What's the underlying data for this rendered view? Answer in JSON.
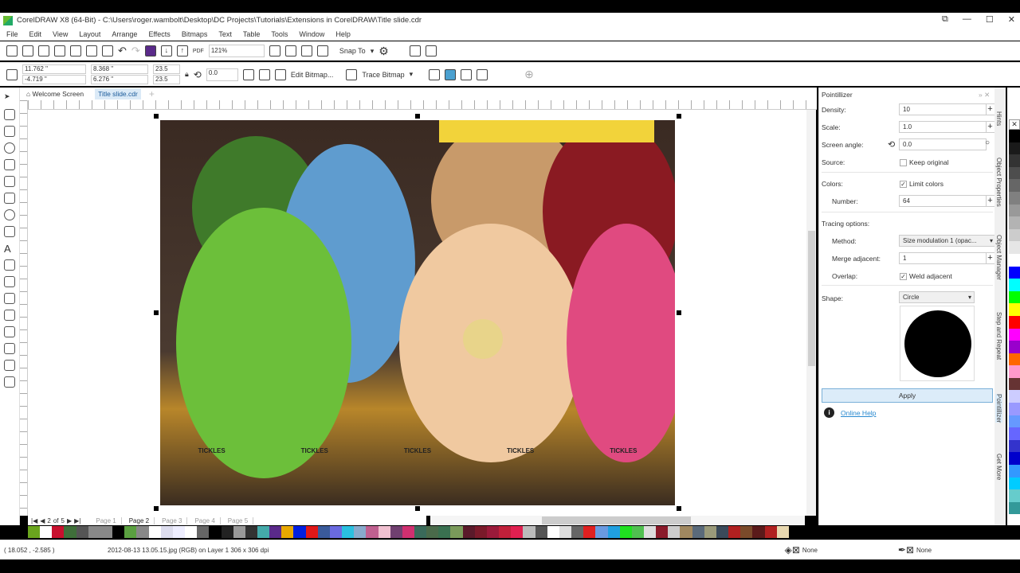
{
  "window": {
    "title": "CorelDRAW X8 (64-Bit) - C:\\Users\\roger.wambolt\\Desktop\\DC Projects\\Tutorials\\Extensions in CorelDRAW\\Title slide.cdr"
  },
  "menu": [
    "File",
    "Edit",
    "View",
    "Layout",
    "Arrange",
    "Effects",
    "Bitmaps",
    "Text",
    "Table",
    "Tools",
    "Window",
    "Help"
  ],
  "toolbar": {
    "zoom": "121%",
    "snap_to": "Snap To"
  },
  "propbar": {
    "x": "11.762 \"",
    "y": "-4.719 \"",
    "w": "8.368 \"",
    "h": "6.276 \"",
    "scale_x": "23.5",
    "scale_y": "23.5",
    "pct": "%",
    "angle": "0.0",
    "edit_bitmap": "Edit Bitmap...",
    "trace_bitmap": "Trace Bitmap"
  },
  "tabs": [
    "Welcome Screen",
    "Title slide.cdr"
  ],
  "pagenav": {
    "current": "2",
    "of": "of",
    "total": "5",
    "pages": [
      "Page 1",
      "Page 2",
      "Page 3",
      "Page 4",
      "Page 5"
    ],
    "active": 1
  },
  "photo_labels": [
    "TICKLES",
    "TICKLES",
    "TICKLES",
    "TICKLES",
    "TICKLES"
  ],
  "status": {
    "coords": "( 18.052 , -2.585 )",
    "info": "2012-08-13 13.05.15.jpg (RGB) on Layer 1 306 x 306 dpi",
    "fill": "None",
    "outline": "None"
  },
  "docker": {
    "title": "Pointillizer",
    "density_label": "Density:",
    "density": "10",
    "scale_label": "Scale:",
    "scale": "1.0",
    "angle_label": "Screen angle:",
    "angle": "0.0",
    "source_label": "Source:",
    "keep_original": "Keep original",
    "keep_original_checked": false,
    "colors_label": "Colors:",
    "limit_colors": "Limit colors",
    "limit_colors_checked": true,
    "number_label": "Number:",
    "number": "64",
    "tracing_label": "Tracing options:",
    "method_label": "Method:",
    "method": "Size modulation 1 (opac...",
    "merge_label": "Merge adjacent:",
    "merge": "1",
    "overlap_label": "Overlap:",
    "weld_adjacent": "Weld adjacent",
    "weld_checked": true,
    "shape_label": "Shape:",
    "shape": "Circle",
    "apply": "Apply",
    "online_help": "Online Help"
  },
  "docker_tabs": [
    "Hints",
    "Object Properties",
    "Object Manager",
    "Step and Repeat",
    "Pointillizer",
    "Get More"
  ],
  "palette_bottom": [
    "#6aa51e",
    "#ffffff",
    "#c8102e",
    "#3f6f3a",
    "#555",
    "#888",
    "#888",
    "#000",
    "#5aa040",
    "#888",
    "#fff",
    "#dde",
    "#eef",
    "#fff",
    "#666",
    "#000",
    "#222",
    "#999",
    "#333",
    "#4aa",
    "#5a2a8a",
    "#e8a800",
    "#0020e0",
    "#e01818",
    "#3a5a9a",
    "#6a6ae0",
    "#2ac0e0",
    "#8ac",
    "#c06090",
    "#f0c0d0",
    "#704070",
    "#d03070",
    "#3a6a5a",
    "#4a6a4a",
    "#3a7050",
    "#7a9a5a",
    "#5a1a2a",
    "#7a1a2a",
    "#9a1a3a",
    "#c0203a",
    "#e02050",
    "#bbb",
    "#555",
    "#fff",
    "#ddd",
    "#666",
    "#e02020",
    "#6a9ae0",
    "#20a0e0",
    "#20e020",
    "#50c050",
    "#ddd",
    "#8a1a2a",
    "#ccc",
    "#a08860",
    "#5a6a7a",
    "#9a9a7a",
    "#3a4a5a",
    "#b02020",
    "#7a4a2a",
    "#5a1a1a",
    "#b02020",
    "#e8d8b0"
  ],
  "palette_right": [
    "#000",
    "#1a1a1a",
    "#333",
    "#4d4d4d",
    "#666",
    "#808080",
    "#999",
    "#b3b3b3",
    "#ccc",
    "#e6e6e6",
    "#fff",
    "#0000ff",
    "#00ffff",
    "#00ff00",
    "#ffff00",
    "#ff0000",
    "#ff00ff",
    "#9900cc",
    "#ff6600",
    "#ff99cc",
    "#663333",
    "#ccccff",
    "#9999ff",
    "#6699ff",
    "#6666ff",
    "#3333cc",
    "#0000cc",
    "#3399ff",
    "#00ccff",
    "#66cccc",
    "#339999"
  ]
}
